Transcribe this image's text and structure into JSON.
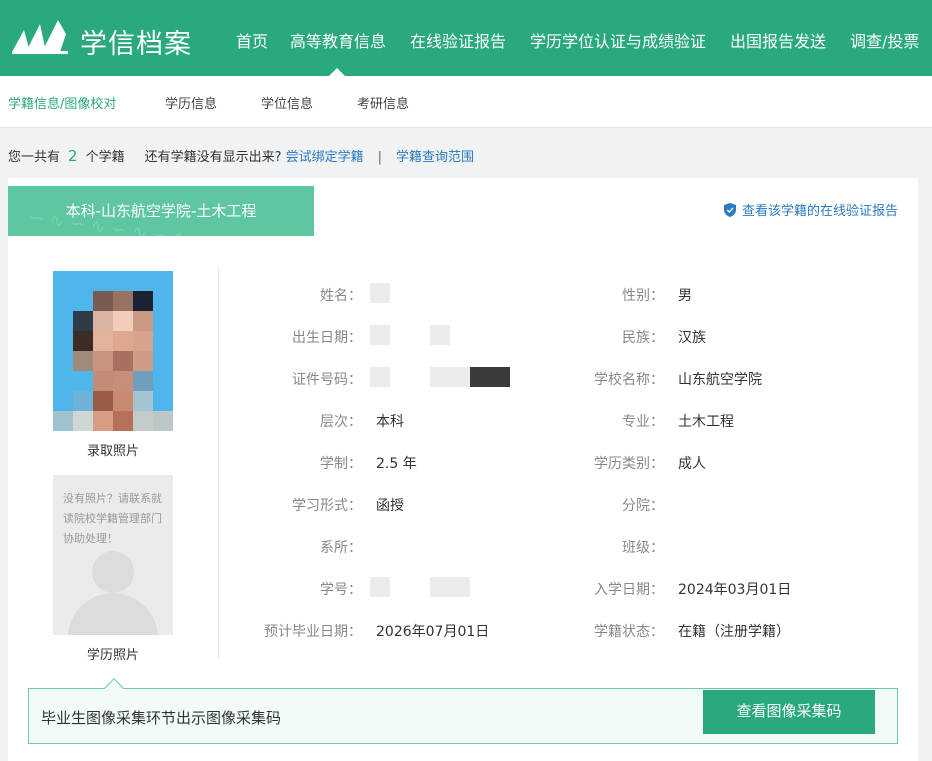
{
  "brand": {
    "name": "学信档案"
  },
  "nav": {
    "items": [
      "首页",
      "高等教育信息",
      "在线验证报告",
      "学历学位认证与成绩验证",
      "出国报告发送",
      "调查/投票"
    ],
    "active_index": 1
  },
  "subnav": {
    "items": [
      "学籍信息/图像校对",
      "学历信息",
      "学位信息",
      "考研信息"
    ],
    "active_index": 0
  },
  "summary": {
    "prefix": "您一共有",
    "count": "2",
    "suffix": "个学籍",
    "question": "还有学籍没有显示出来?",
    "link1": "尝试绑定学籍",
    "separator": "|",
    "link2": "学籍查询范围"
  },
  "card": {
    "tab_title": "本科-山东航空学院-土木工程",
    "verify_link": "查看该学籍的在线验证报告",
    "photo_label": "录取照片",
    "nophoto_text": "没有照片？请联系就读院校学籍管理部门协助处理！",
    "nophoto_label": "学历照片",
    "fields_left": [
      {
        "label": "姓名：",
        "value": ""
      },
      {
        "label": "出生日期：",
        "value": ""
      },
      {
        "label": "证件号码：",
        "value": ""
      },
      {
        "label": "层次：",
        "value": "本科"
      },
      {
        "label": "学制：",
        "value": "2.5 年"
      },
      {
        "label": "学习形式：",
        "value": "函授"
      },
      {
        "label": "系所：",
        "value": ""
      },
      {
        "label": "学号：",
        "value": ""
      },
      {
        "label": "预计毕业日期：",
        "value": "2026年07月01日"
      }
    ],
    "fields_right": [
      {
        "label": "性别：",
        "value": "男"
      },
      {
        "label": "民族：",
        "value": "汉族"
      },
      {
        "label": "学校名称：",
        "value": "山东航空学院"
      },
      {
        "label": "专业：",
        "value": "土木工程"
      },
      {
        "label": "学历类别：",
        "value": "成人"
      },
      {
        "label": "分院：",
        "value": ""
      },
      {
        "label": "班级：",
        "value": ""
      },
      {
        "label": "入学日期：",
        "value": "2024年03月01日"
      },
      {
        "label": "学籍状态：",
        "value": "在籍（注册学籍）"
      }
    ]
  },
  "banner": {
    "text": "毕业生图像采集环节出示图像采集码",
    "button": "查看图像采集码"
  },
  "colors": {
    "brand_green": "#2aa97e",
    "tab_green": "#5fc79f",
    "link_blue": "#2a7ac2"
  }
}
